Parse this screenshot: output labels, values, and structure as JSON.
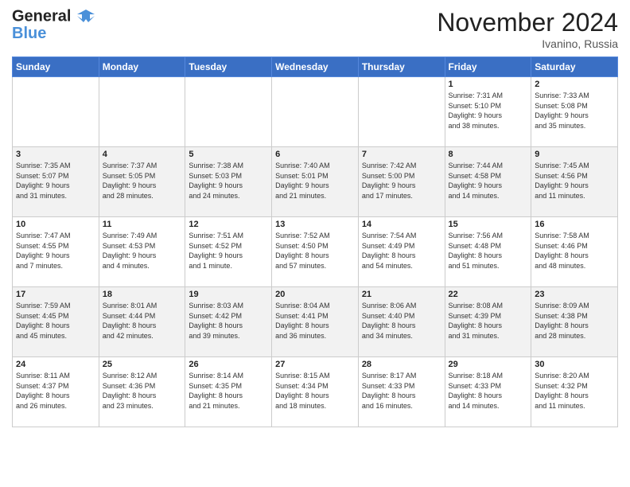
{
  "header": {
    "logo_line1": "General",
    "logo_line2": "Blue",
    "month": "November 2024",
    "location": "Ivanino, Russia"
  },
  "weekdays": [
    "Sunday",
    "Monday",
    "Tuesday",
    "Wednesday",
    "Thursday",
    "Friday",
    "Saturday"
  ],
  "weeks": [
    [
      {
        "day": "",
        "info": ""
      },
      {
        "day": "",
        "info": ""
      },
      {
        "day": "",
        "info": ""
      },
      {
        "day": "",
        "info": ""
      },
      {
        "day": "",
        "info": ""
      },
      {
        "day": "1",
        "info": "Sunrise: 7:31 AM\nSunset: 5:10 PM\nDaylight: 9 hours\nand 38 minutes."
      },
      {
        "day": "2",
        "info": "Sunrise: 7:33 AM\nSunset: 5:08 PM\nDaylight: 9 hours\nand 35 minutes."
      }
    ],
    [
      {
        "day": "3",
        "info": "Sunrise: 7:35 AM\nSunset: 5:07 PM\nDaylight: 9 hours\nand 31 minutes."
      },
      {
        "day": "4",
        "info": "Sunrise: 7:37 AM\nSunset: 5:05 PM\nDaylight: 9 hours\nand 28 minutes."
      },
      {
        "day": "5",
        "info": "Sunrise: 7:38 AM\nSunset: 5:03 PM\nDaylight: 9 hours\nand 24 minutes."
      },
      {
        "day": "6",
        "info": "Sunrise: 7:40 AM\nSunset: 5:01 PM\nDaylight: 9 hours\nand 21 minutes."
      },
      {
        "day": "7",
        "info": "Sunrise: 7:42 AM\nSunset: 5:00 PM\nDaylight: 9 hours\nand 17 minutes."
      },
      {
        "day": "8",
        "info": "Sunrise: 7:44 AM\nSunset: 4:58 PM\nDaylight: 9 hours\nand 14 minutes."
      },
      {
        "day": "9",
        "info": "Sunrise: 7:45 AM\nSunset: 4:56 PM\nDaylight: 9 hours\nand 11 minutes."
      }
    ],
    [
      {
        "day": "10",
        "info": "Sunrise: 7:47 AM\nSunset: 4:55 PM\nDaylight: 9 hours\nand 7 minutes."
      },
      {
        "day": "11",
        "info": "Sunrise: 7:49 AM\nSunset: 4:53 PM\nDaylight: 9 hours\nand 4 minutes."
      },
      {
        "day": "12",
        "info": "Sunrise: 7:51 AM\nSunset: 4:52 PM\nDaylight: 9 hours\nand 1 minute."
      },
      {
        "day": "13",
        "info": "Sunrise: 7:52 AM\nSunset: 4:50 PM\nDaylight: 8 hours\nand 57 minutes."
      },
      {
        "day": "14",
        "info": "Sunrise: 7:54 AM\nSunset: 4:49 PM\nDaylight: 8 hours\nand 54 minutes."
      },
      {
        "day": "15",
        "info": "Sunrise: 7:56 AM\nSunset: 4:48 PM\nDaylight: 8 hours\nand 51 minutes."
      },
      {
        "day": "16",
        "info": "Sunrise: 7:58 AM\nSunset: 4:46 PM\nDaylight: 8 hours\nand 48 minutes."
      }
    ],
    [
      {
        "day": "17",
        "info": "Sunrise: 7:59 AM\nSunset: 4:45 PM\nDaylight: 8 hours\nand 45 minutes."
      },
      {
        "day": "18",
        "info": "Sunrise: 8:01 AM\nSunset: 4:44 PM\nDaylight: 8 hours\nand 42 minutes."
      },
      {
        "day": "19",
        "info": "Sunrise: 8:03 AM\nSunset: 4:42 PM\nDaylight: 8 hours\nand 39 minutes."
      },
      {
        "day": "20",
        "info": "Sunrise: 8:04 AM\nSunset: 4:41 PM\nDaylight: 8 hours\nand 36 minutes."
      },
      {
        "day": "21",
        "info": "Sunrise: 8:06 AM\nSunset: 4:40 PM\nDaylight: 8 hours\nand 34 minutes."
      },
      {
        "day": "22",
        "info": "Sunrise: 8:08 AM\nSunset: 4:39 PM\nDaylight: 8 hours\nand 31 minutes."
      },
      {
        "day": "23",
        "info": "Sunrise: 8:09 AM\nSunset: 4:38 PM\nDaylight: 8 hours\nand 28 minutes."
      }
    ],
    [
      {
        "day": "24",
        "info": "Sunrise: 8:11 AM\nSunset: 4:37 PM\nDaylight: 8 hours\nand 26 minutes."
      },
      {
        "day": "25",
        "info": "Sunrise: 8:12 AM\nSunset: 4:36 PM\nDaylight: 8 hours\nand 23 minutes."
      },
      {
        "day": "26",
        "info": "Sunrise: 8:14 AM\nSunset: 4:35 PM\nDaylight: 8 hours\nand 21 minutes."
      },
      {
        "day": "27",
        "info": "Sunrise: 8:15 AM\nSunset: 4:34 PM\nDaylight: 8 hours\nand 18 minutes."
      },
      {
        "day": "28",
        "info": "Sunrise: 8:17 AM\nSunset: 4:33 PM\nDaylight: 8 hours\nand 16 minutes."
      },
      {
        "day": "29",
        "info": "Sunrise: 8:18 AM\nSunset: 4:33 PM\nDaylight: 8 hours\nand 14 minutes."
      },
      {
        "day": "30",
        "info": "Sunrise: 8:20 AM\nSunset: 4:32 PM\nDaylight: 8 hours\nand 11 minutes."
      }
    ]
  ]
}
